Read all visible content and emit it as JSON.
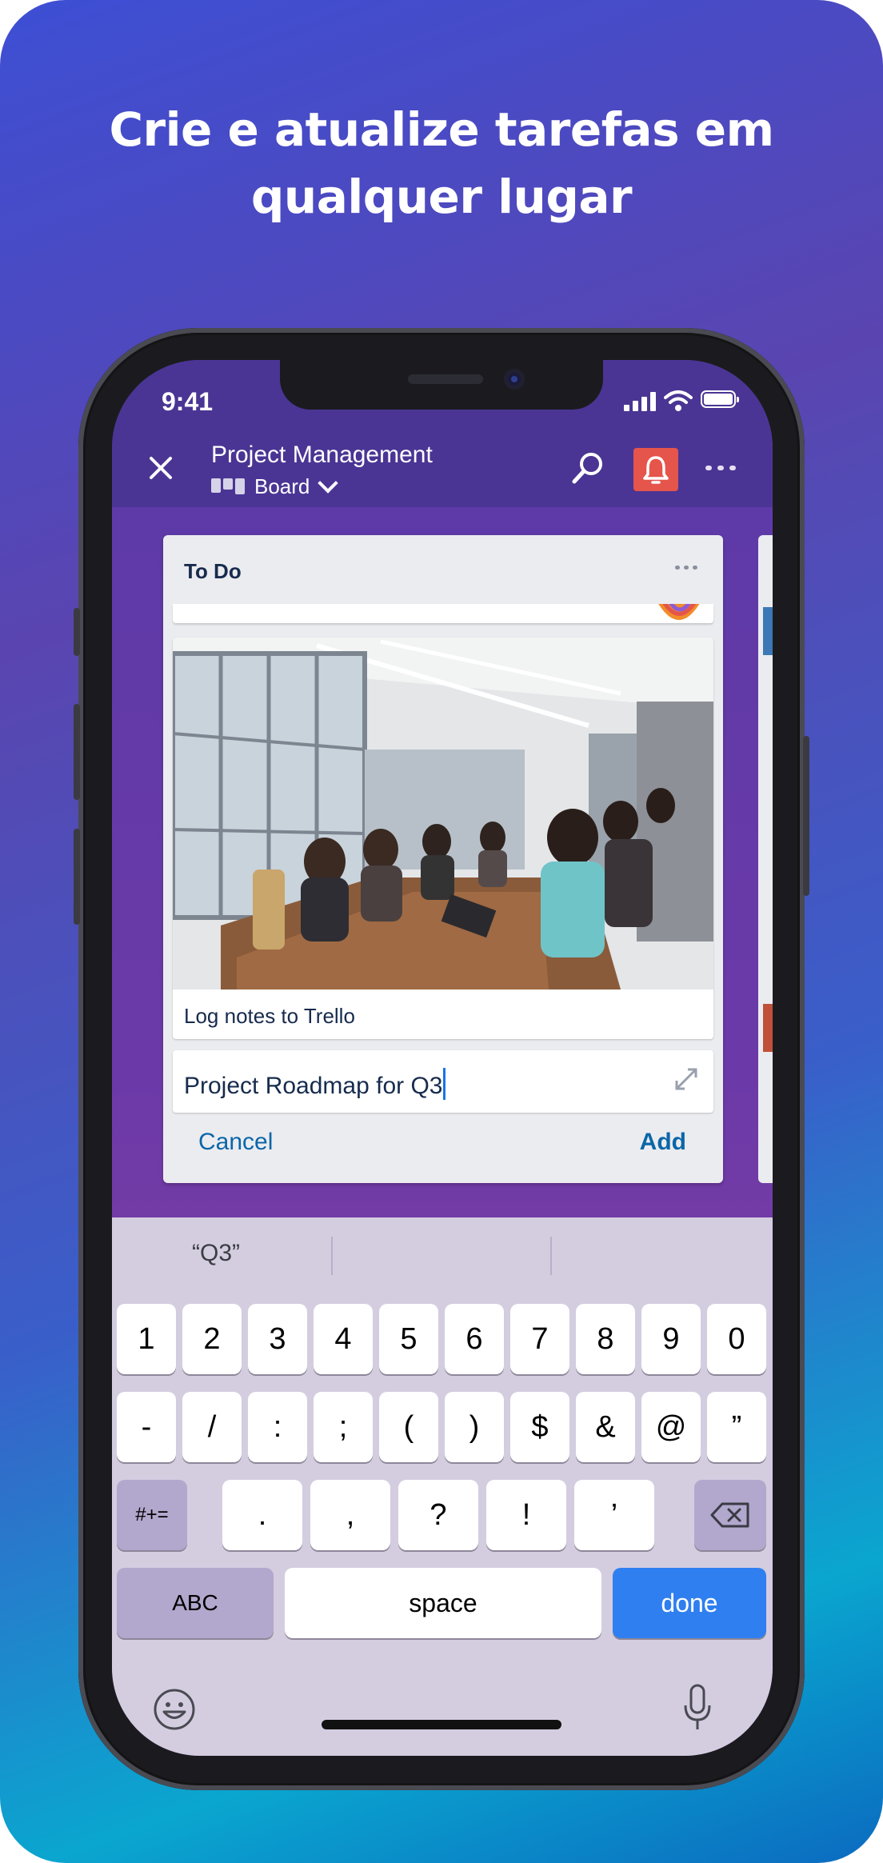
{
  "headline": "Crie e atualize tarefas em qualquer lugar",
  "status_bar": {
    "time": "9:41"
  },
  "app_bar": {
    "board_name": "Project Management",
    "view_label": "Board",
    "accent_bell_color": "#e5554b"
  },
  "list": {
    "title": "To Do",
    "card": {
      "title": "Log notes to Trello",
      "image": "meeting-room-photo"
    },
    "composer": {
      "value": "Project Roadmap for Q3"
    },
    "cancel_label": "Cancel",
    "add_label": "Add"
  },
  "keyboard": {
    "suggestions": [
      "“Q3”",
      "",
      ""
    ],
    "row1": [
      "1",
      "2",
      "3",
      "4",
      "5",
      "6",
      "7",
      "8",
      "9",
      "0"
    ],
    "row2": [
      "-",
      "/",
      ":",
      ";",
      "(",
      ")",
      "$",
      "&",
      "@",
      "”"
    ],
    "row3_left": "#+=",
    "row3": [
      ".",
      ",",
      "?",
      "!",
      "’"
    ],
    "abc": "ABC",
    "space": "space",
    "done": "done"
  },
  "colors": {
    "done_key": "#2f7ff0",
    "link": "#0c66a8",
    "app_bar": "#4a3594"
  }
}
